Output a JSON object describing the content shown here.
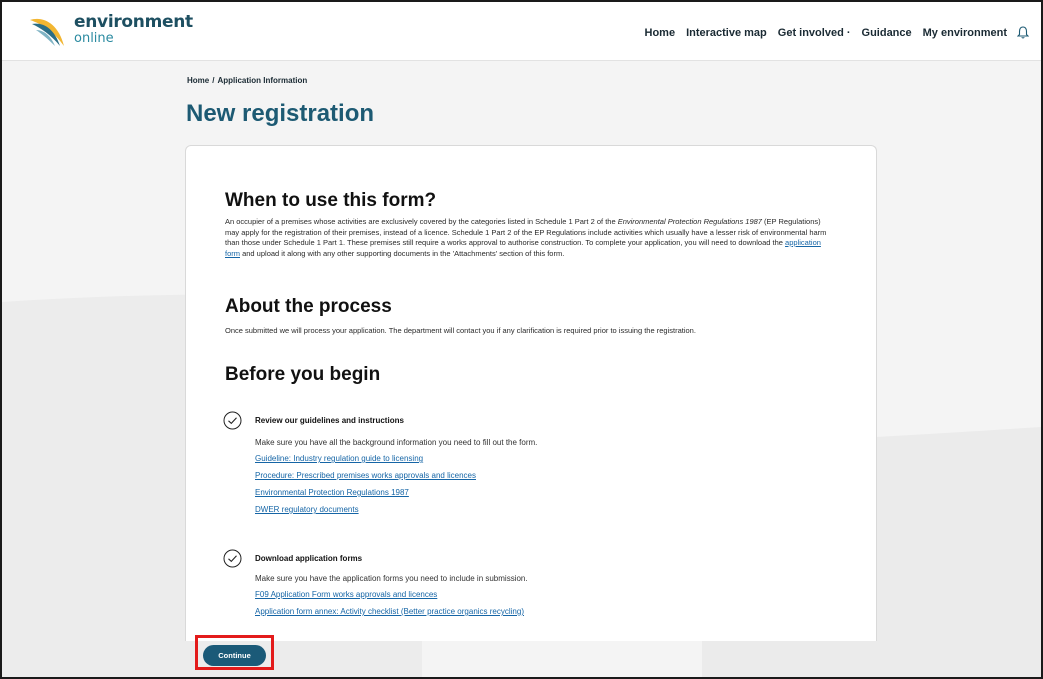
{
  "header": {
    "logo_main": "environment",
    "logo_sub": "online",
    "nav": [
      "Home",
      "Interactive map",
      "Get involved ·",
      "Guidance",
      "My environment"
    ]
  },
  "breadcrumb": {
    "home": "Home",
    "separator": "/",
    "current": "Application Information"
  },
  "page_title": "New registration",
  "when": {
    "heading": "When to use this form?",
    "p1_a": "An occupier of a premises whose activities are exclusively covered by the categories listed in Schedule 1 Part 2 of the ",
    "p1_italic": "Environmental Protection Regulations 1987",
    "p1_b": " (EP Regulations) may apply for the registration of their premises, instead of a licence. Schedule 1 Part 2 of the EP Regulations include activities which usually have a lesser risk of environmental harm than those under Schedule 1 Part 1. These premises still require a works approval to authorise construction. To complete your application, you will need to download the ",
    "p1_link": "application form",
    "p1_c": " and upload it along with any other supporting documents in the 'Attachments' section of this form."
  },
  "about": {
    "heading": "About the process",
    "text": "Once submitted we will process your application. The department will contact you if any clarification is required prior to issuing the registration."
  },
  "before": {
    "heading": "Before you begin"
  },
  "steps": [
    {
      "title": "Review our guidelines and instructions",
      "desc": "Make sure you have all the background information you need to fill out the form.",
      "links": [
        "Guideline: Industry regulation guide to licensing",
        "Procedure: Prescribed premises works approvals and licences",
        "Environmental Protection Regulations 1987",
        "DWER regulatory documents"
      ]
    },
    {
      "title": "Download application forms",
      "desc": "Make sure you have the application forms you need to include in submission.",
      "links": [
        "F09 Application Form works approvals and licences",
        "Application form annex: Activity checklist (Better practice organics recycling)"
      ]
    }
  ],
  "continue_label": "Continue",
  "colors": {
    "brand": "#1d5a73",
    "button": "#1b5a78",
    "link": "#1565a6",
    "highlight": "#e31b1b"
  }
}
